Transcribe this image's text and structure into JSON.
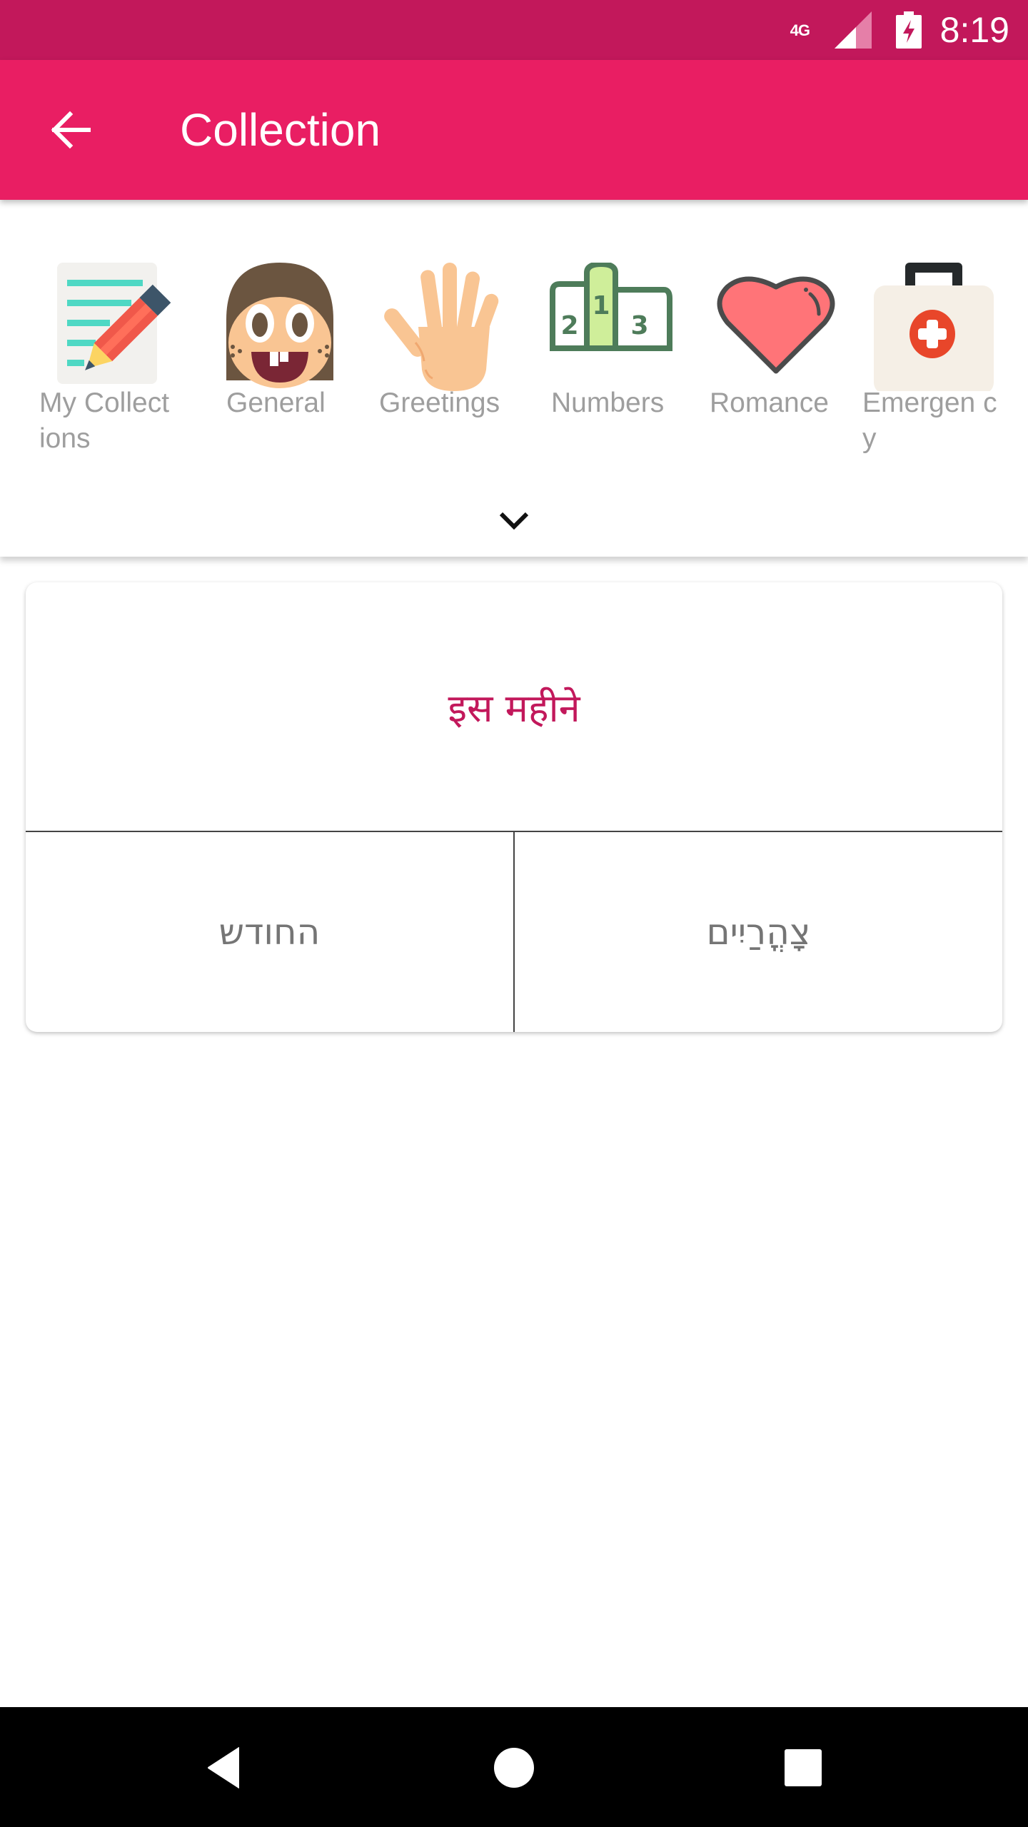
{
  "status_bar": {
    "network_type": "4G",
    "time": "8:19",
    "background_color": "#c2185b"
  },
  "app_bar": {
    "title": "Collection",
    "back_icon": "arrow-left-icon",
    "background_color": "#e91e63"
  },
  "categories": [
    {
      "label": "My Collect ions",
      "icon": "notepad-pencil-icon"
    },
    {
      "label": "General",
      "icon": "face-icon"
    },
    {
      "label": "Greetings",
      "icon": "hand-wave-icon"
    },
    {
      "label": "Numbers",
      "icon": "podium-icon"
    },
    {
      "label": "Romance",
      "icon": "heart-icon"
    },
    {
      "label": "Emergen cy",
      "icon": "first-aid-kit-icon"
    }
  ],
  "expand_icon": "chevron-down-icon",
  "quiz_card": {
    "question": "इस महीने",
    "question_color": "#c2185b",
    "options": [
      {
        "text": "החודש"
      },
      {
        "text": "צָהֳרַיִים"
      }
    ]
  },
  "nav_bar": {
    "back": "back-triangle-icon",
    "home": "home-circle-icon",
    "recents": "recents-square-icon"
  }
}
